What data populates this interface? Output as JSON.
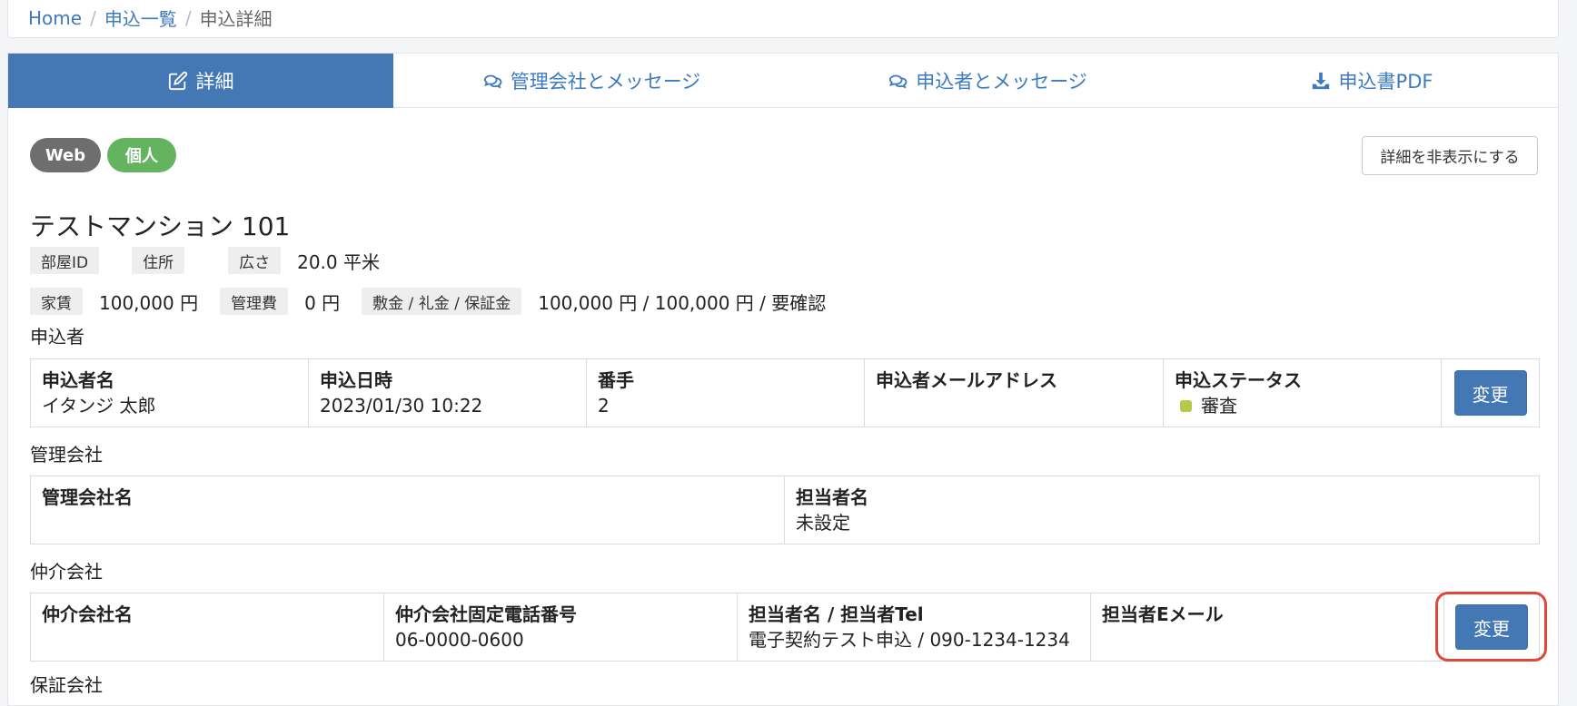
{
  "breadcrumb": {
    "home": "Home",
    "list": "申込一覧",
    "current": "申込詳細"
  },
  "tabs": [
    {
      "label": "詳細",
      "icon": "edit-icon"
    },
    {
      "label": "管理会社とメッセージ",
      "icon": "chat-icon"
    },
    {
      "label": "申込者とメッセージ",
      "icon": "chat-icon"
    },
    {
      "label": "申込書PDF",
      "icon": "download-icon"
    }
  ],
  "badges": {
    "web": "Web",
    "kojin": "個人"
  },
  "hide_details_label": "詳細を非表示にする",
  "property": {
    "title": "テストマンション 101",
    "room_id_label": "部屋ID",
    "address_label": "住所",
    "area_label": "広さ",
    "area_value": "20.0 平米",
    "rent_label": "家賃",
    "rent_value": "100,000 円",
    "fee_label": "管理費",
    "fee_value": "0 円",
    "deposit_label": "敷金 / 礼金 / 保証金",
    "deposit_value": "100,000 円 / 100,000 円 / 要確認"
  },
  "applicant": {
    "section": "申込者",
    "name_head": "申込者名",
    "name_value": "イタンジ 太郎",
    "date_head": "申込日時",
    "date_value": "2023/01/30 10:22",
    "order_head": "番手",
    "order_value": "2",
    "email_head": "申込者メールアドレス",
    "email_value": "",
    "status_head": "申込ステータス",
    "status_value": "審査",
    "status_color": "#b5c94a",
    "change_label": "変更"
  },
  "management": {
    "section": "管理会社",
    "company_head": "管理会社名",
    "company_value": "",
    "person_head": "担当者名",
    "person_value": "未設定"
  },
  "broker": {
    "section": "仲介会社",
    "company_head": "仲介会社名",
    "company_value": "",
    "tel_head": "仲介会社固定電話番号",
    "tel_value": "06-0000-0600",
    "person_head": "担当者名 / 担当者Tel",
    "person_value": "電子契約テスト申込 / 090-1234-1234",
    "email_head": "担当者Eメール",
    "email_value": "",
    "change_label": "変更"
  },
  "guarantor": {
    "section": "保証会社"
  },
  "colors": {
    "accent": "#4378b5",
    "highlight": "#e0473b"
  }
}
